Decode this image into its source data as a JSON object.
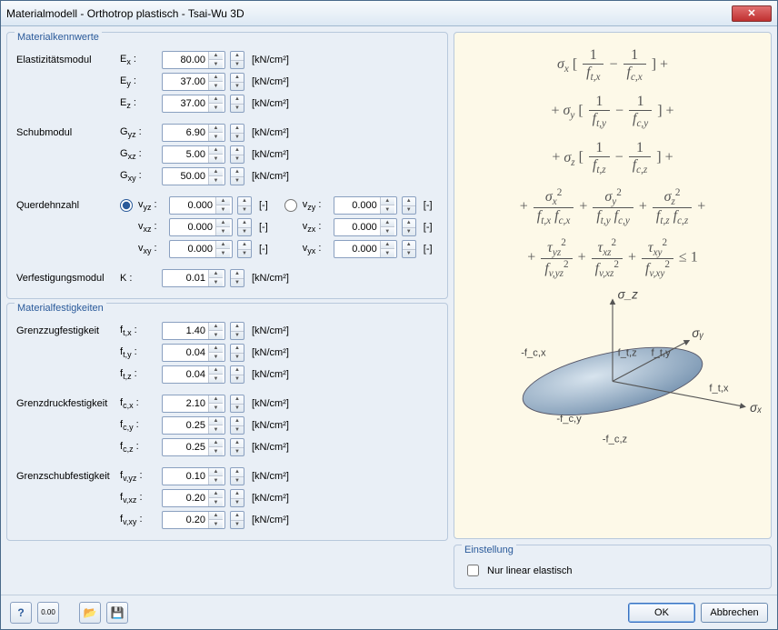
{
  "window": {
    "title": "Materialmodell - Orthotrop plastisch - Tsai-Wu 3D"
  },
  "groups": {
    "kenn": "Materialkennwerte",
    "fest": "Materialfestigkeiten",
    "setting": "Einstellung"
  },
  "labels": {
    "emodul": "Elastizitätsmodul",
    "schub": "Schubmodul",
    "quer": "Querdehnzahl",
    "verf": "Verfestigungsmodul",
    "zug": "Grenzzugfestigkeit",
    "druck": "Grenzdruckfestigkeit",
    "gschub": "Grenzschubfestigkeit"
  },
  "sym": {
    "Ex": "E<sub>x</sub> :",
    "Ey": "E<sub>y</sub> :",
    "Ez": "E<sub>z</sub> :",
    "Gyz": "G<sub>yz</sub> :",
    "Gxz": "G<sub>xz</sub> :",
    "Gxy": "G<sub>xy</sub> :",
    "vyz": "v<sub>yz</sub> :",
    "vxz": "v<sub>xz</sub> :",
    "vxy": "v<sub>xy</sub> :",
    "vzy": "v<sub>zy</sub> :",
    "vzx": "v<sub>zx</sub> :",
    "vyx": "v<sub>yx</sub> :",
    "K": "K :",
    "ftx": "f<sub>t,x</sub> :",
    "fty": "f<sub>t,y</sub> :",
    "ftz": "f<sub>t,z</sub> :",
    "fcx": "f<sub>c,x</sub> :",
    "fcy": "f<sub>c,y</sub> :",
    "fcz": "f<sub>c,z</sub> :",
    "fvyz": "f<sub>v,yz</sub> :",
    "fvxz": "f<sub>v,xz</sub> :",
    "fvxy": "f<sub>v,xy</sub> :"
  },
  "vals": {
    "Ex": "80.00",
    "Ey": "37.00",
    "Ez": "37.00",
    "Gyz": "6.90",
    "Gxz": "5.00",
    "Gxy": "50.00",
    "vyz": "0.000",
    "vxz": "0.000",
    "vxy": "0.000",
    "vzy": "0.000",
    "vzx": "0.000",
    "vyx": "0.000",
    "K": "0.01",
    "ftx": "1.40",
    "fty": "0.04",
    "ftz": "0.04",
    "fcx": "2.10",
    "fcy": "0.25",
    "fcz": "0.25",
    "fvyz": "0.10",
    "fvxz": "0.20",
    "fvxy": "0.20"
  },
  "units": {
    "kncm2": "[kN/cm²]",
    "none": "[-]"
  },
  "setting": {
    "linear": "Nur linear elastisch"
  },
  "buttons": {
    "ok": "OK",
    "cancel": "Abbrechen"
  },
  "chart_data": {
    "type": "other",
    "description": "Tsai-Wu 3D failure criterion formula and stress ellipsoid in σx/σy/σz space",
    "formula_terms": [
      "σx [ 1/f_t,x − 1/f_c,x ] +",
      "+ σy [ 1/f_t,y − 1/f_c,y ] +",
      "+ σz [ 1/f_t,z − 1/f_c,z ] +",
      "+ σx²/(f_t,x f_c,x) + σy²/(f_t,y f_c,y) + σz²/(f_t,z f_c,z) +",
      "+ τ_yz²/f_v,yz² + τ_xz²/f_v,xz² + τ_xy²/f_v,xy² ≤ 1"
    ],
    "axes": [
      "σx",
      "σy",
      "σz"
    ],
    "axis_labels": [
      "f_t,x",
      "-f_c,x",
      "f_t,y",
      "-f_c,y",
      "f_t,z",
      "-f_c,z"
    ]
  }
}
